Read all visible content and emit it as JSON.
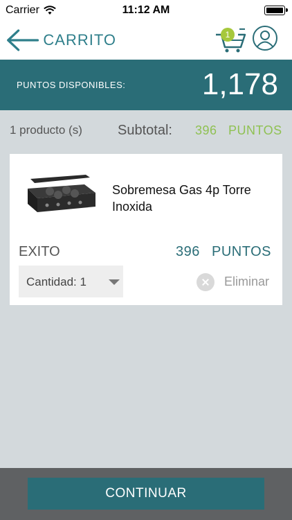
{
  "status_bar": {
    "carrier": "Carrier",
    "time": "11:12 AM"
  },
  "header": {
    "title": "CARRITO",
    "cart_count": "1"
  },
  "points": {
    "label": "PUNTOS DISPONIBLES:",
    "value": "1,178"
  },
  "summary": {
    "count": "1 producto (s)",
    "subtotal_label": "Subtotal:",
    "subtotal_value": "396",
    "subtotal_unit": "PUNTOS"
  },
  "product": {
    "name": "Sobremesa Gas 4p Torre Inoxida",
    "store": "EXITO",
    "price": "396",
    "price_unit": "PUNTOS",
    "quantity_label": "Cantidad: 1",
    "remove_label": "Eliminar"
  },
  "footer": {
    "continue_label": "CONTINUAR"
  },
  "colors": {
    "teal": "#2a6d77",
    "green": "#8fc152",
    "badge": "#a6c83c"
  }
}
